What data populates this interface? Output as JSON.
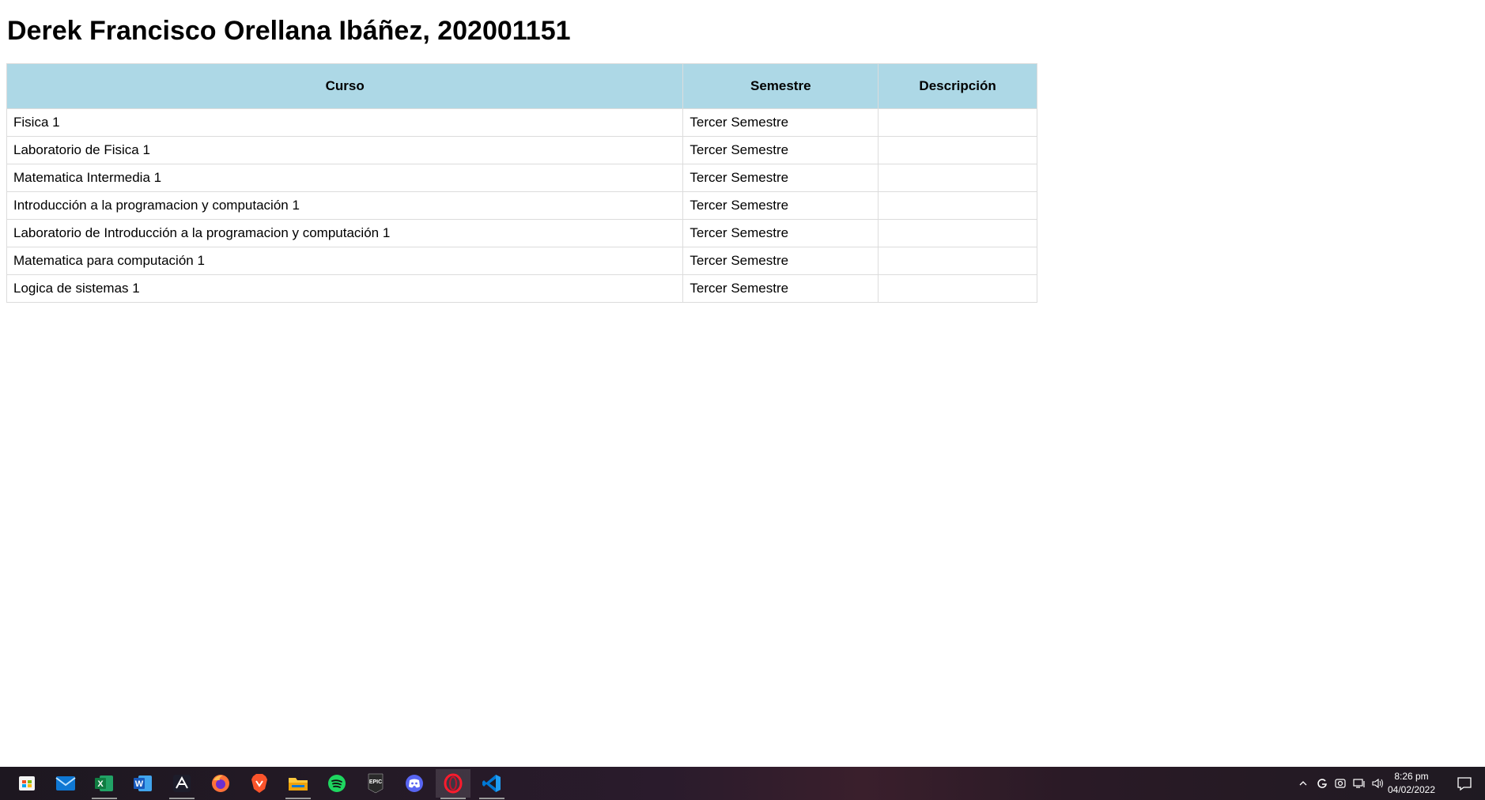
{
  "page": {
    "title": "Derek Francisco Orellana Ibáñez, 202001151"
  },
  "table": {
    "headers": [
      "Curso",
      "Semestre",
      "Descripción"
    ],
    "rows": [
      {
        "curso": "Fisica 1",
        "semestre": "Tercer Semestre",
        "descripcion": ""
      },
      {
        "curso": "Laboratorio de Fisica 1",
        "semestre": "Tercer Semestre",
        "descripcion": ""
      },
      {
        "curso": "Matematica Intermedia 1",
        "semestre": "Tercer Semestre",
        "descripcion": ""
      },
      {
        "curso": "Introducción a la programacion y computación 1",
        "semestre": "Tercer Semestre",
        "descripcion": ""
      },
      {
        "curso": "Laboratorio de Introducción a la programacion y computación 1",
        "semestre": "Tercer Semestre",
        "descripcion": ""
      },
      {
        "curso": "Matematica para computación 1",
        "semestre": "Tercer Semestre",
        "descripcion": ""
      },
      {
        "curso": "Logica de sistemas 1",
        "semestre": "Tercer Semestre",
        "descripcion": ""
      }
    ],
    "header_color": "#add8e6"
  },
  "taskbar": {
    "apps": [
      {
        "name": "start",
        "icon": "windows-start-icon"
      },
      {
        "name": "mail",
        "icon": "mail-icon"
      },
      {
        "name": "excel",
        "icon": "excel-icon",
        "label": "X"
      },
      {
        "name": "word",
        "icon": "word-icon",
        "label": "W"
      },
      {
        "name": "acrobat",
        "icon": "acrobat-icon"
      },
      {
        "name": "firefox",
        "icon": "firefox-icon"
      },
      {
        "name": "brave",
        "icon": "brave-icon"
      },
      {
        "name": "file-explorer",
        "icon": "folder-icon"
      },
      {
        "name": "spotify",
        "icon": "spotify-icon"
      },
      {
        "name": "epic-games",
        "icon": "epic-games-icon",
        "label": "EPIC"
      },
      {
        "name": "discord",
        "icon": "discord-icon"
      },
      {
        "name": "opera",
        "icon": "opera-icon"
      },
      {
        "name": "vscode",
        "icon": "vscode-icon"
      }
    ],
    "clock": {
      "time": "8:26 pm",
      "date": "04/02/2022"
    }
  }
}
